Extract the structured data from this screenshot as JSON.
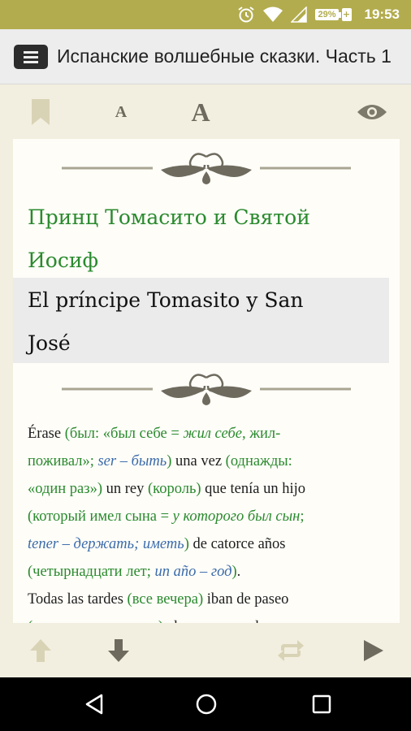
{
  "status_bar": {
    "battery_percent": "29%",
    "time": "19:53"
  },
  "title_bar": {
    "title": "Испанские волшебные сказки. Часть 1"
  },
  "toolbar": {
    "font_small_label": "A",
    "font_large_label": "A"
  },
  "page": {
    "title_ru_line1": "Принц Томасито и Святой",
    "title_ru_line2": "Иосиф",
    "title_es_line1": "El príncipe Tomasito y San",
    "title_es_line2": "José",
    "body_lines": [
      [
        {
          "t": "Érase ",
          "c": ""
        },
        {
          "t": "(был: «был себе = ",
          "c": "g"
        },
        {
          "t": "жил себе",
          "c": "gi"
        },
        {
          "t": ", жил-",
          "c": "g"
        }
      ],
      [
        {
          "t": "поживал»; ",
          "c": "g"
        },
        {
          "t": "ser – быть",
          "c": "b"
        },
        {
          "t": ")",
          "c": "g"
        },
        {
          "t": " una vez ",
          "c": ""
        },
        {
          "t": "(однажды:",
          "c": "g"
        }
      ],
      [
        {
          "t": "«один раз»)",
          "c": "g"
        },
        {
          "t": " un rey ",
          "c": ""
        },
        {
          "t": "(король)",
          "c": "g"
        },
        {
          "t": " que tenía un hijo",
          "c": ""
        }
      ],
      [
        {
          "t": "(который имел сына = ",
          "c": "g"
        },
        {
          "t": "у которого был сын",
          "c": "gi"
        },
        {
          "t": ";",
          "c": "g"
        }
      ],
      [
        {
          "t": "tener – держать; иметь",
          "c": "b"
        },
        {
          "t": ")",
          "c": "g"
        },
        {
          "t": " de catorce años",
          "c": ""
        }
      ],
      [
        {
          "t": "(четырнадцати лет; ",
          "c": "g"
        },
        {
          "t": "un año – год",
          "c": "b"
        },
        {
          "t": ")",
          "c": "g"
        },
        {
          "t": ".",
          "c": ""
        }
      ],
      [
        {
          "t": "Todas las tardes ",
          "c": ""
        },
        {
          "t": "(все вечера)",
          "c": "g"
        },
        {
          "t": " iban de paseo",
          "c": ""
        }
      ],
      [
        {
          "t": "(ходили на прогулку)",
          "c": "g"
        },
        {
          "t": " el monarca y el",
          "c": ""
        }
      ]
    ]
  },
  "colors": {
    "status_bar": "#b2ac4e",
    "russian_text": "#2a8a2e",
    "italic_note": "#3a6aaa",
    "page_background": "#fefdf8",
    "app_background": "#f2efe0"
  },
  "icons": {
    "status": [
      "alarm-icon",
      "wifi-icon",
      "signal-icon",
      "battery-icon"
    ],
    "toolbar": [
      "bookmark-icon",
      "font-decrease-icon",
      "font-increase-icon",
      "eye-icon"
    ],
    "bottom": [
      "arrow-up-icon",
      "arrow-down-icon",
      "repeat-icon",
      "play-icon"
    ],
    "nav": [
      "back-icon",
      "home-icon",
      "recents-icon"
    ]
  }
}
